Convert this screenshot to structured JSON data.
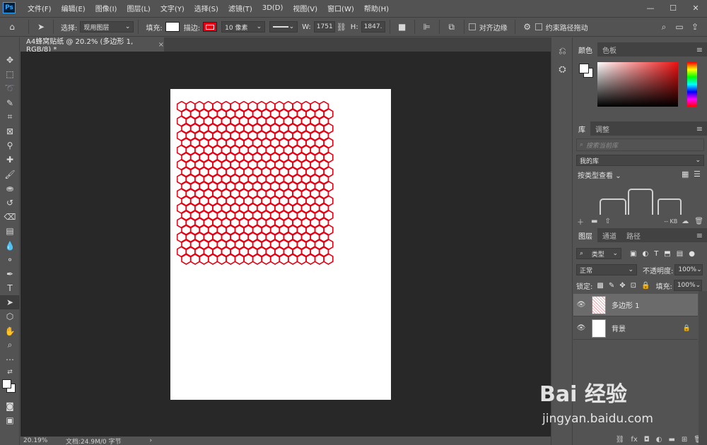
{
  "app": {
    "logo": "Ps"
  },
  "menu": [
    "文件(F)",
    "编辑(E)",
    "图像(I)",
    "图层(L)",
    "文字(Y)",
    "选择(S)",
    "滤镜(T)",
    "3D(D)",
    "视图(V)",
    "窗口(W)",
    "帮助(H)"
  ],
  "window_controls": {
    "minimize": "—",
    "maximize": "☐",
    "close": "✕"
  },
  "options": {
    "select_label": "选择:",
    "select_value": "现用图层",
    "fill_label": "填充:",
    "stroke_label": "描边:",
    "stroke_width": "10 像素",
    "w_label": "W:",
    "w_value": "1751.13",
    "h_label": "H:",
    "h_value": "1847.97",
    "align_edges": "对齐边缘",
    "constrain_path": "约束路径拖动",
    "stroke_color": "#e60012",
    "fill_color": "#ffffff"
  },
  "document": {
    "tab_title": "A4蜂窝贴纸 @ 20.2% (多边形 1, RGB/8) *",
    "close": "×",
    "hex_color": "#e60012"
  },
  "status": {
    "zoom": "20.19%",
    "doc_info": "文档:24.9M/0 字节",
    "arrow": "›"
  },
  "panels": {
    "color": {
      "tabs": [
        "颜色",
        "色板"
      ]
    },
    "library": {
      "tabs": [
        "库",
        "调整"
      ],
      "search_placeholder": "搜索当前库",
      "library_name": "我的库",
      "view_by": "按类型查看",
      "size": "-- KB"
    },
    "layers": {
      "tabs": [
        "图层",
        "通道",
        "路径"
      ],
      "filter": "类型",
      "blend_mode": "正常",
      "opacity_label": "不透明度:",
      "opacity_value": "100%",
      "lock_label": "锁定:",
      "fill_label": "填充:",
      "fill_value": "100%",
      "items": [
        {
          "name": "多边形 1",
          "selected": true
        },
        {
          "name": "背景",
          "selected": false
        }
      ]
    }
  },
  "watermark": {
    "brand": "Bai 经验",
    "url": "jingyan.baidu.com"
  }
}
